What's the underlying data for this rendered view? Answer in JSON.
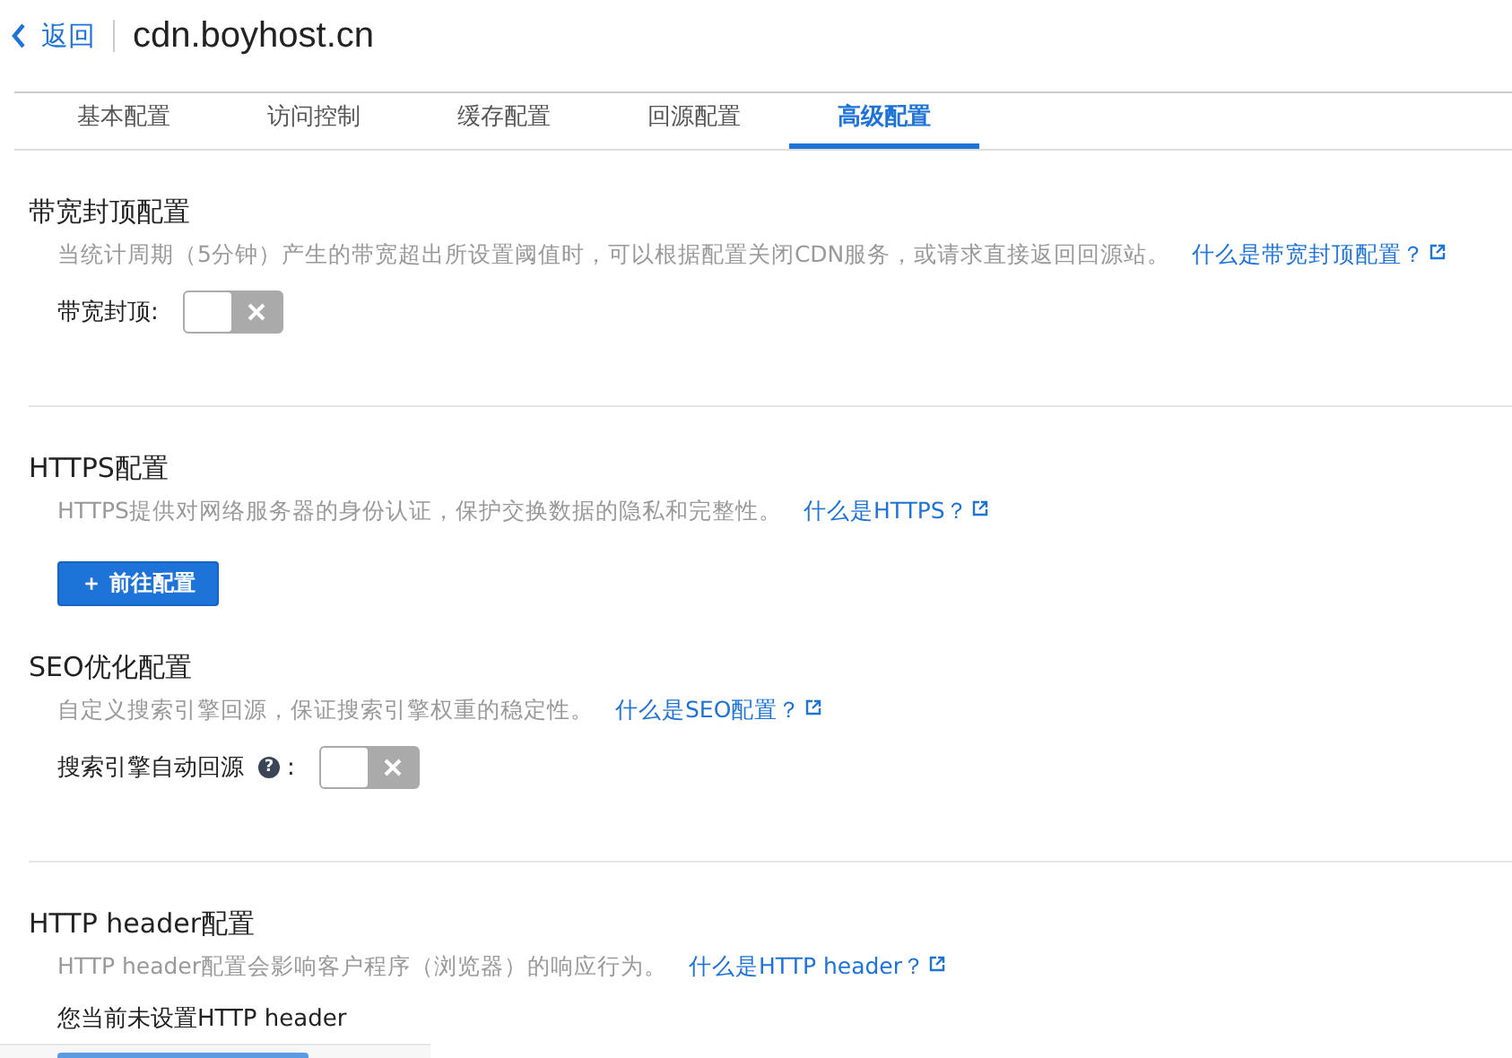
{
  "header": {
    "back": "返回",
    "title": "cdn.boyhost.cn"
  },
  "tabs": [
    {
      "label": "基本配置",
      "selected": false
    },
    {
      "label": "访问控制",
      "selected": false
    },
    {
      "label": "缓存配置",
      "selected": false
    },
    {
      "label": "回源配置",
      "selected": false
    },
    {
      "label": "高级配置",
      "selected": true
    }
  ],
  "groups": [
    {
      "sections": [
        {
          "title": "带宽封顶配置",
          "description": "当统计周期（5分钟）产生的带宽超出所设置阈值时，可以根据配置关闭CDN服务，或请求直接返回回源站。",
          "link": "什么是带宽封顶配置？",
          "kind": "toggle",
          "label": "带宽封顶:",
          "on": false
        }
      ]
    },
    {
      "sections": [
        {
          "title": "HTTPS配置",
          "description": "HTTPS提供对网络服务器的身份认证，保护交换数据的隐私和完整性。",
          "link": "什么是HTTPS？",
          "kind": "button",
          "button": "＋ 前往配置"
        },
        {
          "title": "SEO优化配置",
          "description": "自定义搜索引擎回源，保证搜索引擎权重的稳定性。",
          "link": "什么是SEO配置？",
          "kind": "toggle",
          "label": "搜索引擎自动回源",
          "help_mark": "?",
          "suffix": ":",
          "on": false
        }
      ]
    },
    {
      "sections": [
        {
          "title": "HTTP header配置",
          "description": "HTTP header配置会影响客户程序（浏览器）的响应行为。",
          "link": "什么是HTTP header？",
          "kind": "note",
          "note": "您当前未设置HTTP header"
        }
      ]
    }
  ]
}
